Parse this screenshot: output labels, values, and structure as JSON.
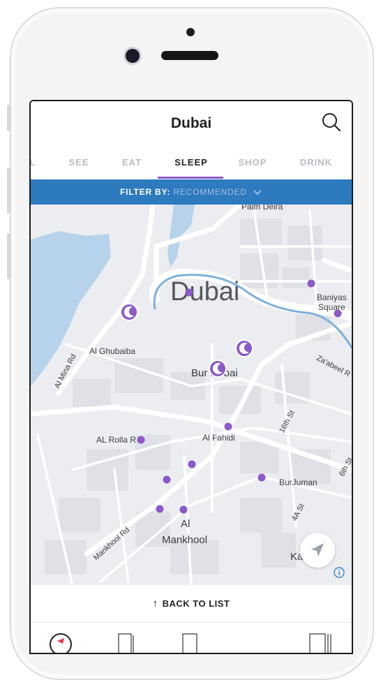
{
  "app": {
    "title": "Dubai"
  },
  "tabs": [
    {
      "label": "L",
      "active": false
    },
    {
      "label": "SEE",
      "active": false
    },
    {
      "label": "EAT",
      "active": false
    },
    {
      "label": "SLEEP",
      "active": true
    },
    {
      "label": "SHOP",
      "active": false
    },
    {
      "label": "DRINK",
      "active": false
    }
  ],
  "filter": {
    "label": "FILTER BY:",
    "value": "RECOMMENDED"
  },
  "map": {
    "city_label": "Dubai",
    "labels": [
      "Palm Deira",
      "Baniyas",
      "Square",
      "Al Ghubaiba",
      "Al Mina Rd",
      "Bur Dubai",
      "Za'abeel R",
      "16th St",
      "AL Rolla R",
      "Al Fahidi",
      "6th St",
      "BurJuman",
      "4A St",
      "Mankhool Rd",
      "Al",
      "Mankhool",
      "Ka"
    ],
    "marker_color": "#8b59c9",
    "water_color": "#b6d3eb",
    "creek_line_color": "#7fb0db"
  },
  "bottom": {
    "back_label": "BACK TO LIST"
  }
}
